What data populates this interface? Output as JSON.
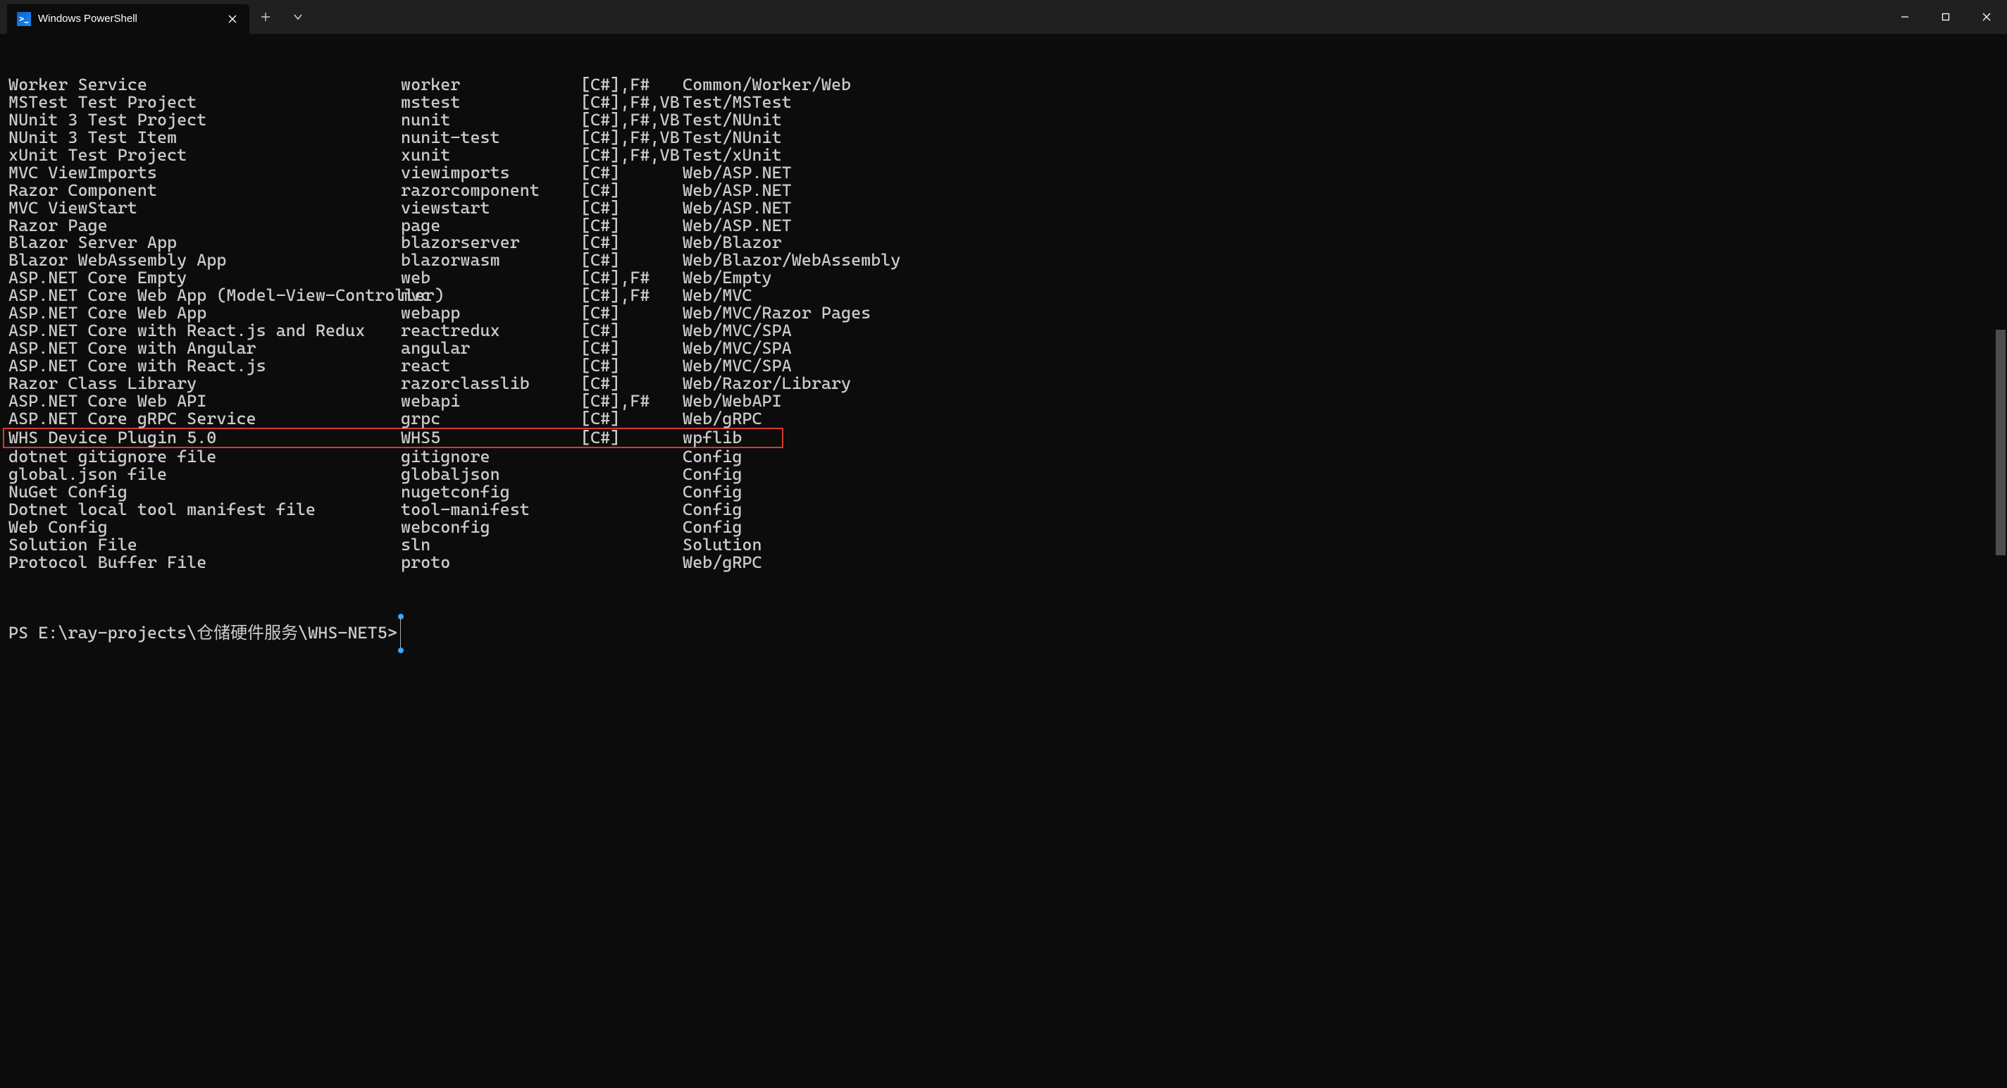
{
  "tab": {
    "title": "Windows PowerShell",
    "icon": "powershell-icon"
  },
  "rows": [
    {
      "name": "Worker Service",
      "short": "worker",
      "langs": "[C#],F#",
      "tags": "Common/Worker/Web"
    },
    {
      "name": "MSTest Test Project",
      "short": "mstest",
      "langs": "[C#],F#,VB",
      "tags": "Test/MSTest"
    },
    {
      "name": "NUnit 3 Test Project",
      "short": "nunit",
      "langs": "[C#],F#,VB",
      "tags": "Test/NUnit"
    },
    {
      "name": "NUnit 3 Test Item",
      "short": "nunit-test",
      "langs": "[C#],F#,VB",
      "tags": "Test/NUnit"
    },
    {
      "name": "xUnit Test Project",
      "short": "xunit",
      "langs": "[C#],F#,VB",
      "tags": "Test/xUnit"
    },
    {
      "name": "MVC ViewImports",
      "short": "viewimports",
      "langs": "[C#]",
      "tags": "Web/ASP.NET"
    },
    {
      "name": "Razor Component",
      "short": "razorcomponent",
      "langs": "[C#]",
      "tags": "Web/ASP.NET"
    },
    {
      "name": "MVC ViewStart",
      "short": "viewstart",
      "langs": "[C#]",
      "tags": "Web/ASP.NET"
    },
    {
      "name": "Razor Page",
      "short": "page",
      "langs": "[C#]",
      "tags": "Web/ASP.NET"
    },
    {
      "name": "Blazor Server App",
      "short": "blazorserver",
      "langs": "[C#]",
      "tags": "Web/Blazor"
    },
    {
      "name": "Blazor WebAssembly App",
      "short": "blazorwasm",
      "langs": "[C#]",
      "tags": "Web/Blazor/WebAssembly"
    },
    {
      "name": "ASP.NET Core Empty",
      "short": "web",
      "langs": "[C#],F#",
      "tags": "Web/Empty"
    },
    {
      "name": "ASP.NET Core Web App (Model-View-Controller)",
      "short": "mvc",
      "langs": "[C#],F#",
      "tags": "Web/MVC"
    },
    {
      "name": "ASP.NET Core Web App",
      "short": "webapp",
      "langs": "[C#]",
      "tags": "Web/MVC/Razor Pages"
    },
    {
      "name": "ASP.NET Core with React.js and Redux",
      "short": "reactredux",
      "langs": "[C#]",
      "tags": "Web/MVC/SPA"
    },
    {
      "name": "ASP.NET Core with Angular",
      "short": "angular",
      "langs": "[C#]",
      "tags": "Web/MVC/SPA"
    },
    {
      "name": "ASP.NET Core with React.js",
      "short": "react",
      "langs": "[C#]",
      "tags": "Web/MVC/SPA"
    },
    {
      "name": "Razor Class Library",
      "short": "razorclasslib",
      "langs": "[C#]",
      "tags": "Web/Razor/Library"
    },
    {
      "name": "ASP.NET Core Web API",
      "short": "webapi",
      "langs": "[C#],F#",
      "tags": "Web/WebAPI"
    },
    {
      "name": "ASP.NET Core gRPC Service",
      "short": "grpc",
      "langs": "[C#]",
      "tags": "Web/gRPC"
    },
    {
      "name": "WHS Device Plugin 5.0",
      "short": "WHS5",
      "langs": "[C#]",
      "tags": "wpflib",
      "highlight": true
    },
    {
      "name": "dotnet gitignore file",
      "short": "gitignore",
      "langs": "",
      "tags": "Config"
    },
    {
      "name": "global.json file",
      "short": "globaljson",
      "langs": "",
      "tags": "Config"
    },
    {
      "name": "NuGet Config",
      "short": "nugetconfig",
      "langs": "",
      "tags": "Config"
    },
    {
      "name": "Dotnet local tool manifest file",
      "short": "tool-manifest",
      "langs": "",
      "tags": "Config"
    },
    {
      "name": "Web Config",
      "short": "webconfig",
      "langs": "",
      "tags": "Config"
    },
    {
      "name": "Solution File",
      "short": "sln",
      "langs": "",
      "tags": "Solution"
    },
    {
      "name": "Protocol Buffer File",
      "short": "proto",
      "langs": "",
      "tags": "Web/gRPC"
    }
  ],
  "prompt": "PS E:\\ray-projects\\仓储硬件服务\\WHS-NET5>"
}
